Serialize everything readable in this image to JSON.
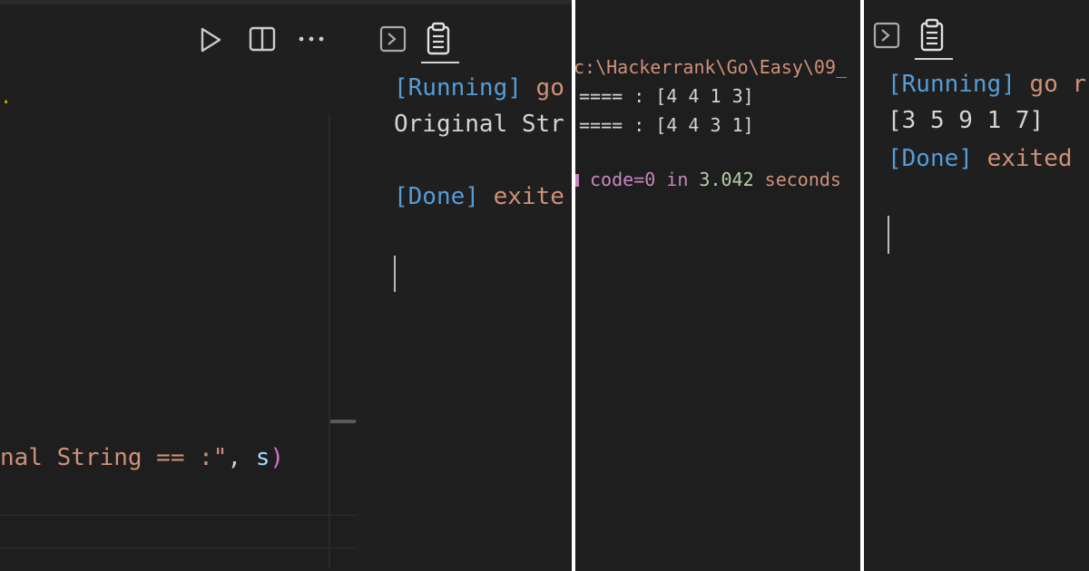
{
  "panel1": {
    "code_line": {
      "string_part": "nal String == :\"",
      "comma": ", ",
      "var": "s",
      "paren": ")"
    },
    "dot": ".",
    "output": {
      "running_tag": "[Running]",
      "running_cmd": " go",
      "original_line": "Original Str",
      "done_tag": "[Done]",
      "done_text": " exite"
    },
    "toolbar_icons": [
      "run-icon",
      "split-editor-icon",
      "more-actions-icon"
    ],
    "output_tabs": [
      "terminal-icon",
      "output-clipboard-icon"
    ]
  },
  "panel2": {
    "path_line": "c:\\Hackerrank\\Go\\Easy\\09_",
    "result1": "==== : [4 4 1 3]",
    "result2": "==== : [4 4 3 1]",
    "exit_prefix": "",
    "exit_code": "code=0",
    "exit_in": " in ",
    "exit_time": "3.042",
    "exit_seconds": " seconds"
  },
  "panel3": {
    "running_tag": "[Running]",
    "running_cmd": " go r",
    "result": "[3 5 9 1 7]",
    "done_tag": "[Done]",
    "done_text": " exited",
    "tabs": [
      "terminal-icon",
      "output-clipboard-icon"
    ]
  },
  "colors": {
    "background": "#1f1f1f",
    "keyword_blue": "#569cd6",
    "string_orange": "#ce9178",
    "purple": "#c586c0",
    "number_green": "#b5cea8"
  }
}
